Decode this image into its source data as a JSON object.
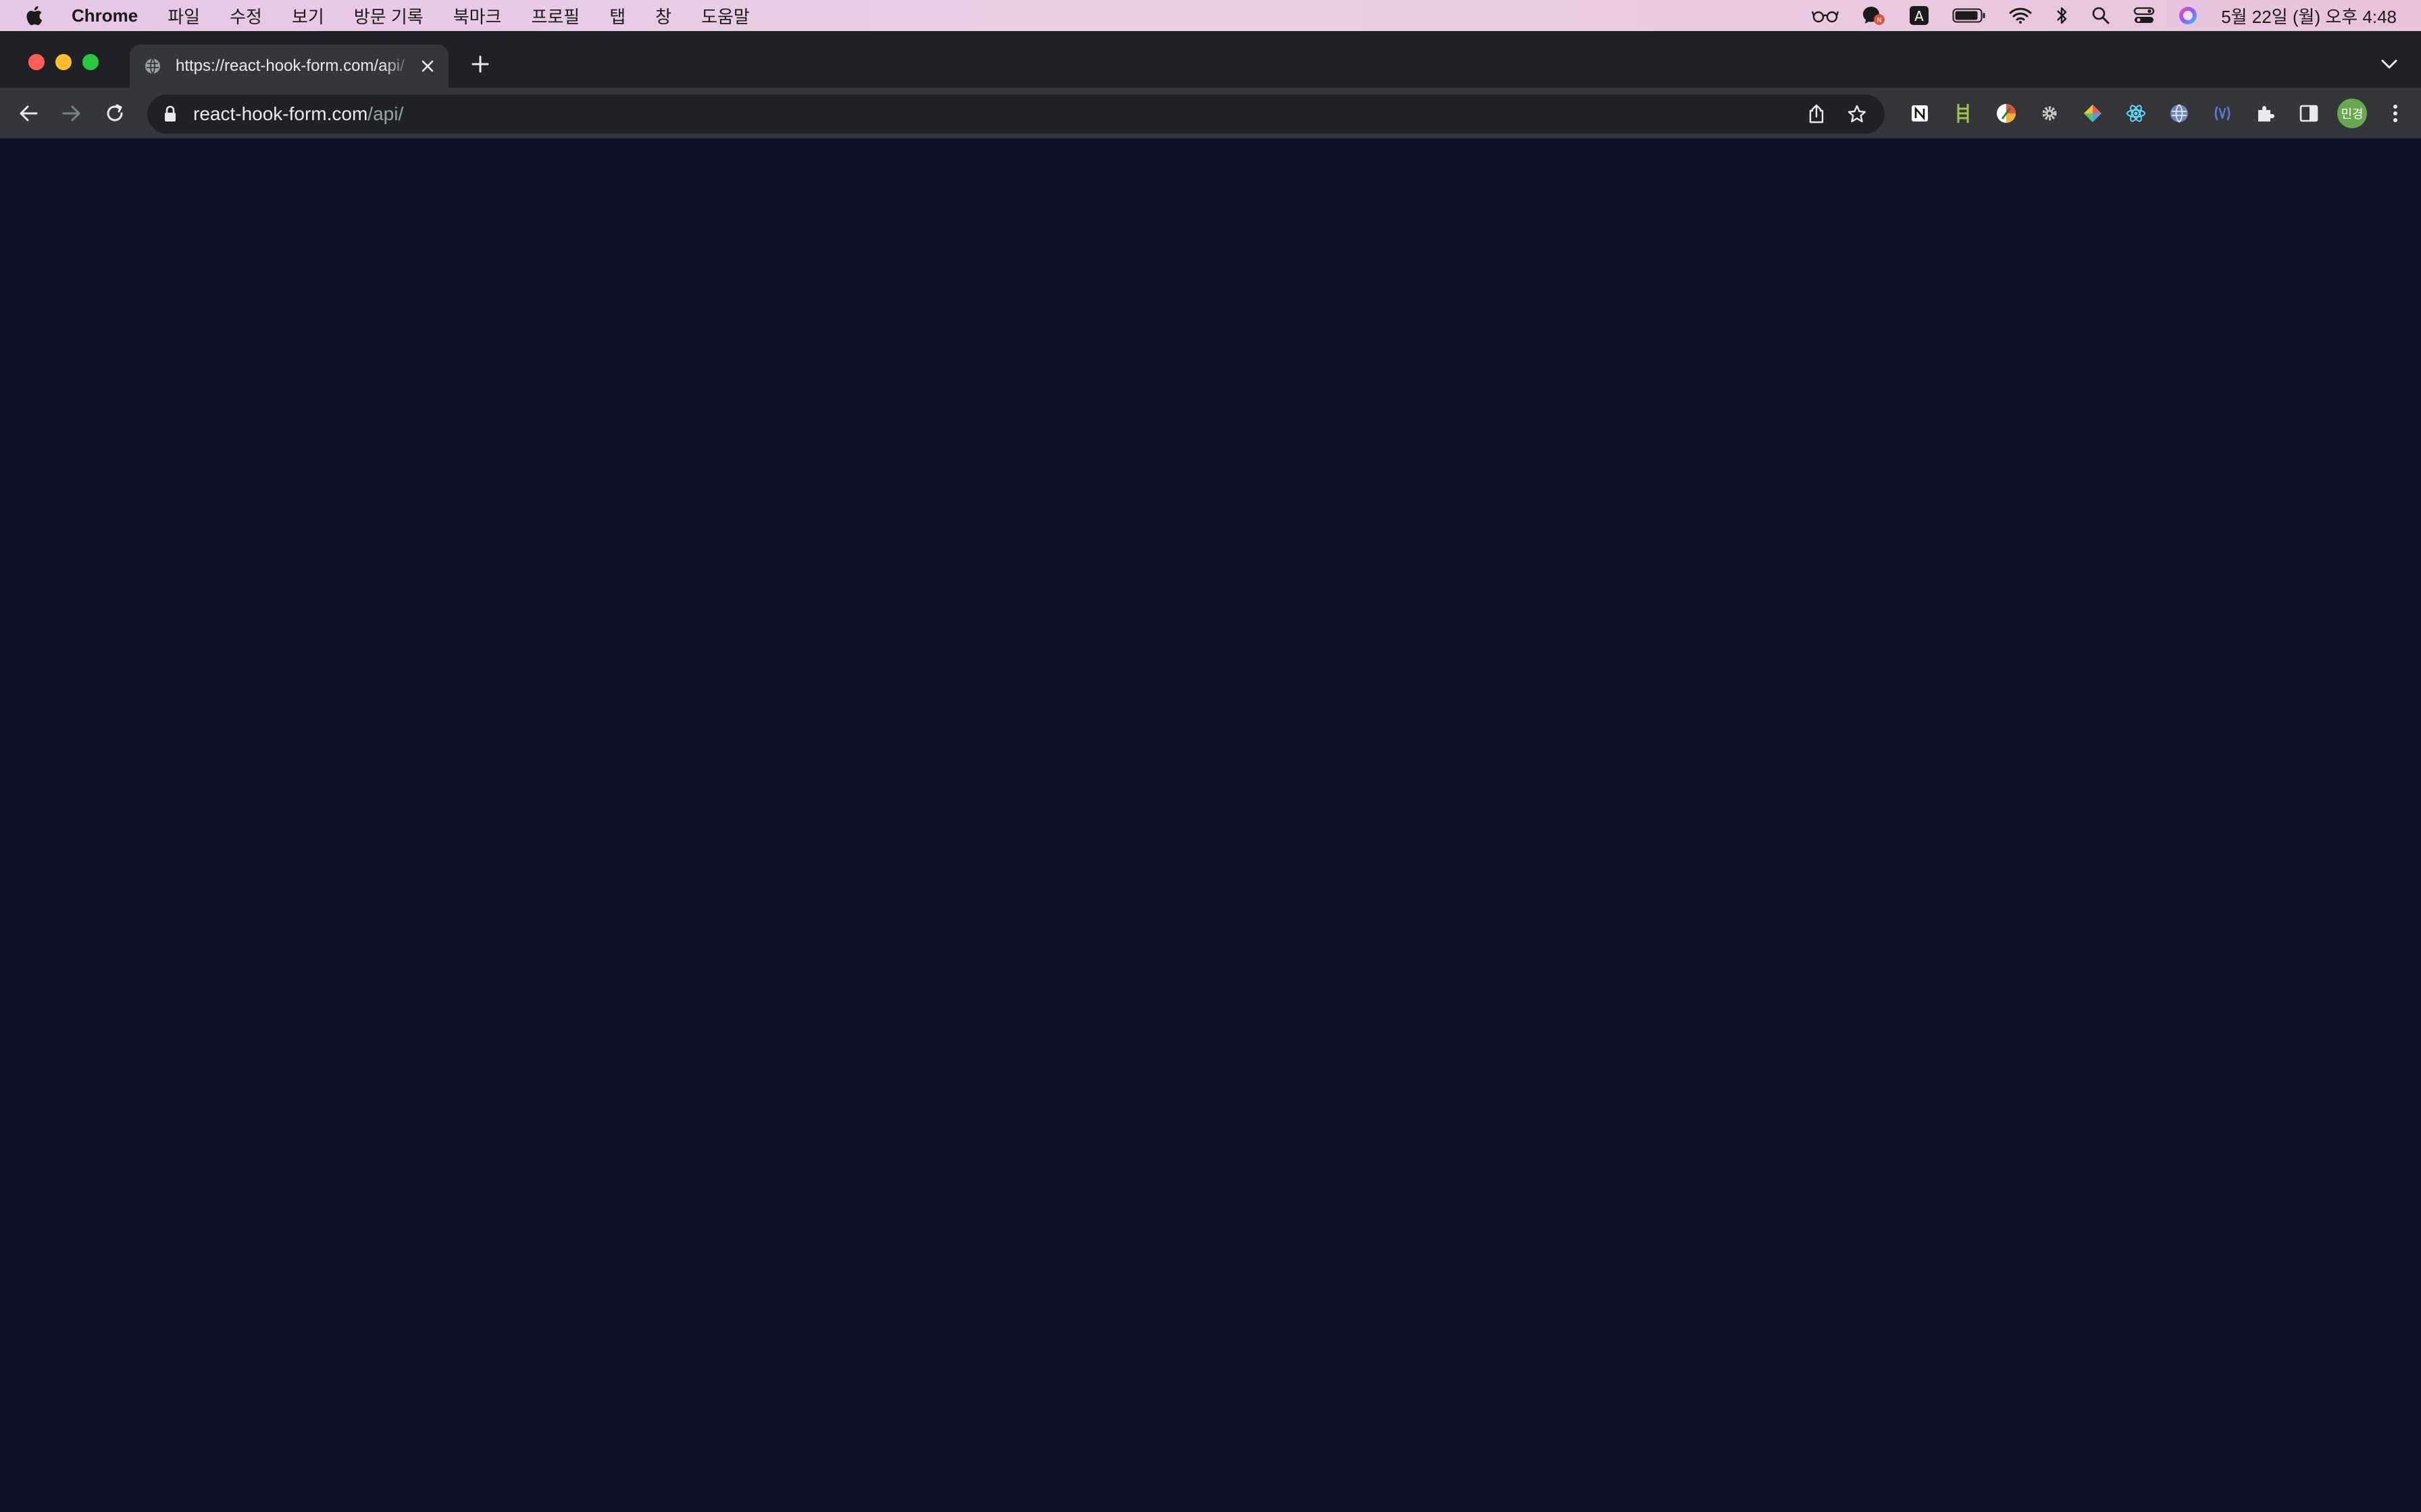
{
  "menubar": {
    "app_name": "Chrome",
    "menus": [
      "파일",
      "수정",
      "보기",
      "방문 기록",
      "북마크",
      "프로필",
      "탭",
      "창",
      "도움말"
    ],
    "clock": "5월 22일 (월) 오후 4:48",
    "tray_icons": [
      "glasses-icon",
      "messenger-icon",
      "input-source-icon",
      "battery-icon",
      "wifi-icon",
      "bluetooth-icon",
      "spotlight-icon",
      "control-center-icon",
      "siri-icon"
    ],
    "input_source_label": "A"
  },
  "browser": {
    "tab": {
      "title": "https://react-hook-form.com/api/"
    },
    "address_bar": {
      "host": "react-hook-form.com",
      "path": "/api/"
    },
    "profile_initials": "민경",
    "extensions": [
      "notion-extension-icon",
      "ruler-extension-icon",
      "color-picker-extension-icon",
      "gear-extension-icon",
      "color-palette-extension-icon",
      "react-devtools-extension-icon",
      "globe-extension-icon",
      "api-extension-icon"
    ]
  },
  "colors": {
    "page_background": "#0a1128",
    "menubar_background": "#e8c8e6",
    "chrome_frame": "#202124",
    "toolbar": "#35363a"
  }
}
